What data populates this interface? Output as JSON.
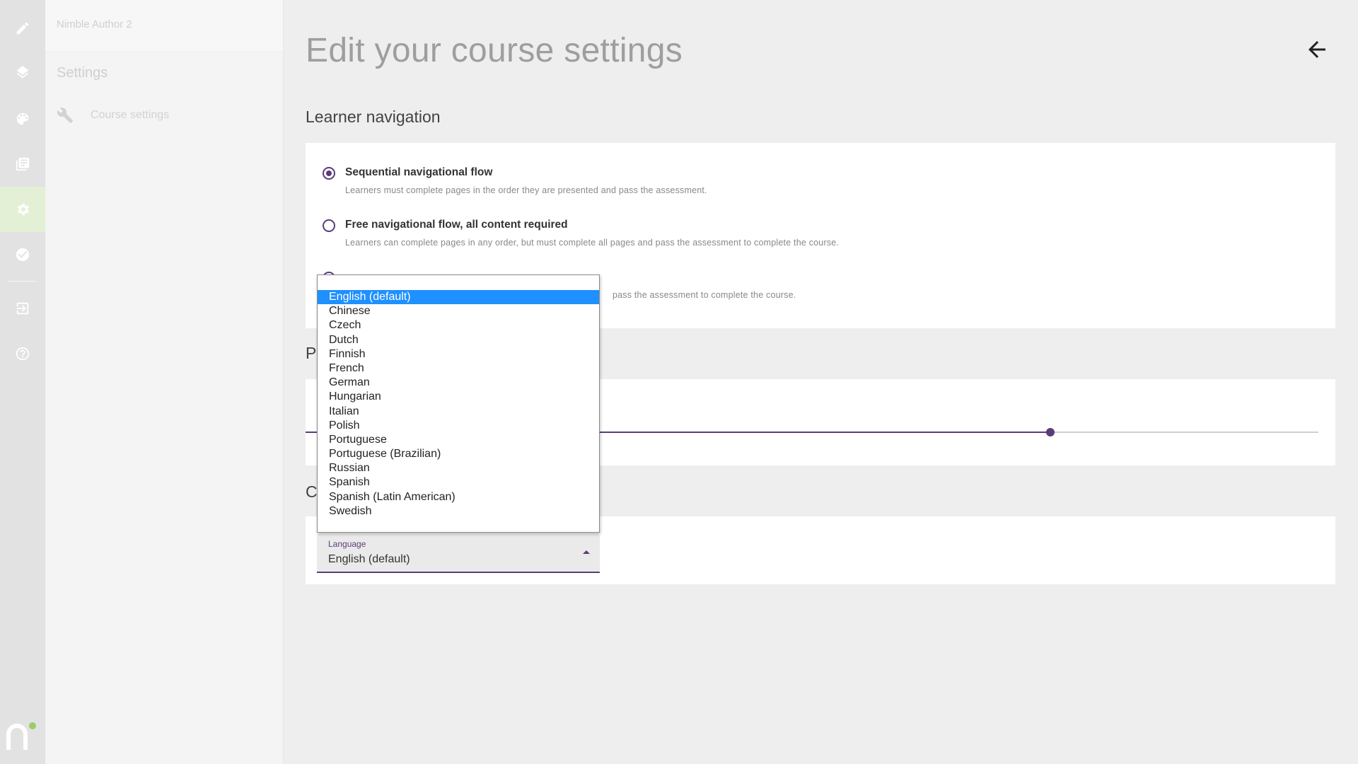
{
  "app": {
    "name": "Nimble Author 2"
  },
  "rail": {
    "items": [
      {
        "icon": "pencil-icon"
      },
      {
        "icon": "layers-icon"
      },
      {
        "icon": "palette-icon"
      },
      {
        "icon": "library-icon"
      },
      {
        "icon": "gear-icon",
        "active": true
      },
      {
        "icon": "check-circle-icon"
      },
      {
        "icon": "import-icon"
      },
      {
        "icon": "help-icon"
      }
    ],
    "logo": "nimble-logo"
  },
  "sidebar": {
    "heading": "Settings",
    "items": [
      {
        "label": "Course settings",
        "icon": "wrench-icon"
      }
    ]
  },
  "page": {
    "title": "Edit your course settings"
  },
  "learner_navigation": {
    "heading": "Learner navigation",
    "options": [
      {
        "label": "Sequential navigational flow",
        "description": "Learners must complete pages in the order they are presented and pass the assessment.",
        "checked": true
      },
      {
        "label": "Free navigational flow, all content required",
        "description": "Learners can complete pages in any order, but must complete all pages and pass the assessment to complete the course.",
        "checked": false
      },
      {
        "label": "",
        "description": "pass the assessment to complete the course.",
        "checked": false
      }
    ]
  },
  "section_two": {
    "heading_visible": "P",
    "slider_fraction": 0.735
  },
  "section_three": {
    "heading_visible": "C"
  },
  "language": {
    "label": "Language",
    "value": "English (default)",
    "options": [
      "English (default)",
      "Chinese",
      "Czech",
      "Dutch",
      "Finnish",
      "French",
      "German",
      "Hungarian",
      "Italian",
      "Polish",
      "Portuguese",
      "Portuguese (Brazilian)",
      "Russian",
      "Spanish",
      "Spanish (Latin American)",
      "Swedish"
    ],
    "selected_index": 0
  },
  "colors": {
    "accent": "#5b3b7a",
    "highlight": "#1e90ff",
    "rail_active": "#e3f0d5",
    "logo_dot": "#9ccc65"
  }
}
